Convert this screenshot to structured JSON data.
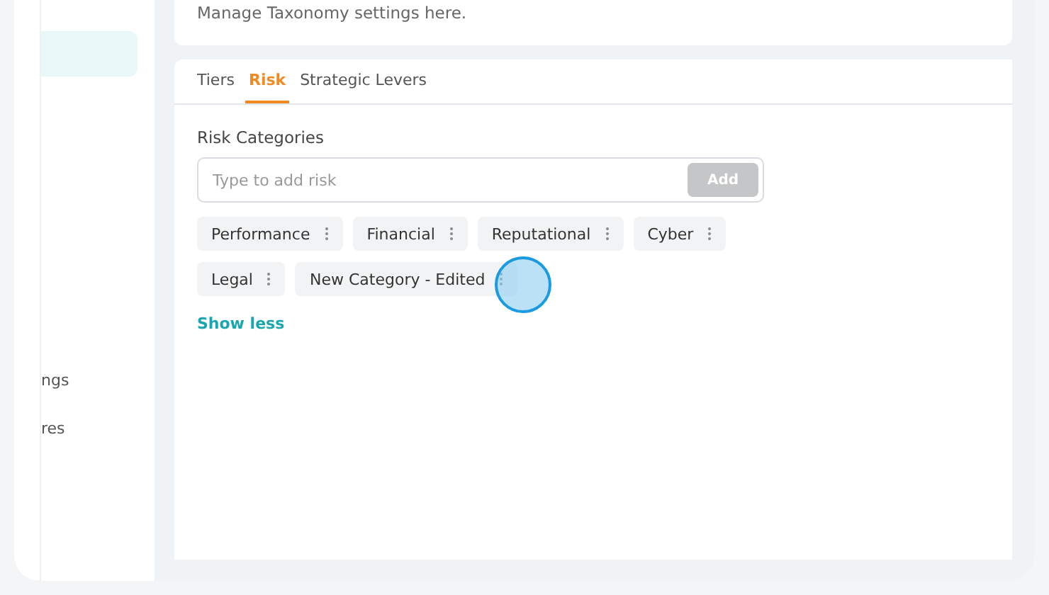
{
  "sidebar": {
    "items": [
      {
        "selected": true
      },
      {
        "label": "ngs",
        "selected": false
      },
      {
        "label": "res",
        "selected": false
      }
    ]
  },
  "header": {
    "subtitle": "Manage Taxonomy settings here."
  },
  "tabs": [
    {
      "label": "Tiers",
      "selected": false
    },
    {
      "label": "Risk",
      "selected": true
    },
    {
      "label": "Strategic Levers",
      "selected": false
    }
  ],
  "section_title": "Risk Categories",
  "add_field": {
    "placeholder": "Type to add risk",
    "button": "Add"
  },
  "categories": [
    "Performance",
    "Financial",
    "Reputational",
    "Cyber",
    "Legal",
    "New Category - Edited"
  ],
  "toggle_link": "Show less"
}
